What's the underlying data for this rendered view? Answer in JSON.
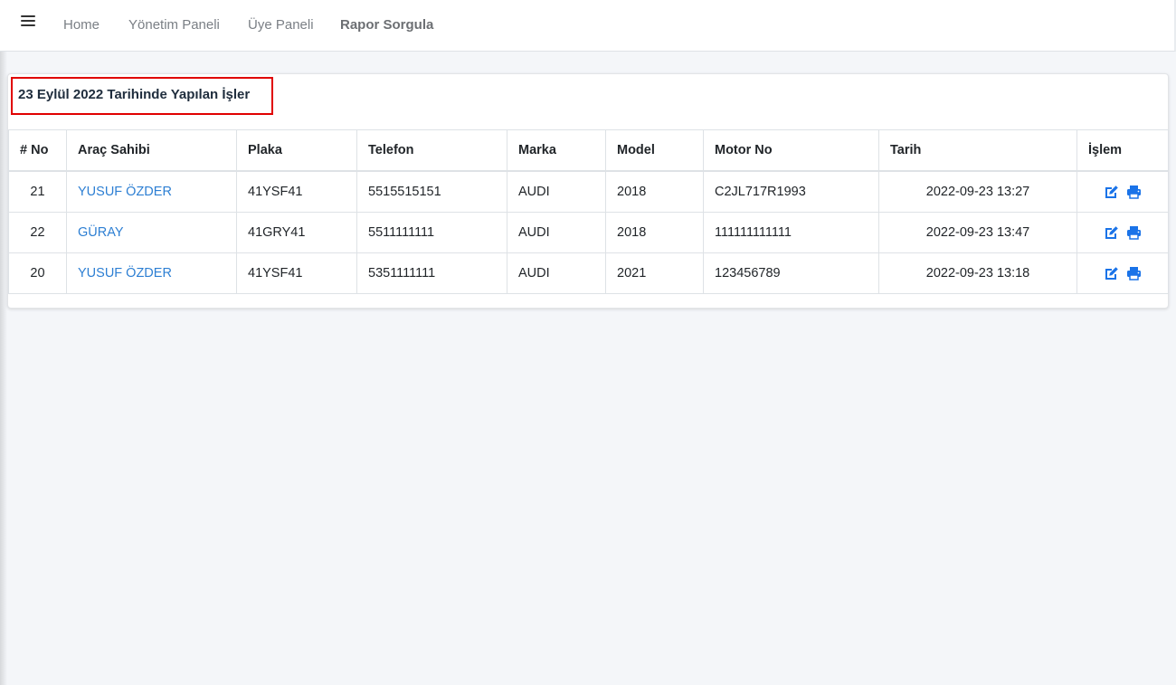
{
  "navbar": {
    "menu_icon": "hamburger-menu-icon",
    "links": [
      {
        "label": "Home"
      },
      {
        "label": "Yönetim Paneli"
      },
      {
        "label": "Üye Paneli"
      },
      {
        "label": "Rapor Sorgula"
      }
    ]
  },
  "card": {
    "title": "23 Eylül 2022 Tarihinde Yapılan İşler",
    "highlight_color": "#e00000"
  },
  "table": {
    "headers": [
      "# No",
      "Araç Sahibi",
      "Plaka",
      "Telefon",
      "Marka",
      "Model",
      "Motor No",
      "Tarih",
      "İşlem"
    ],
    "rows": [
      {
        "no": "21",
        "owner": "YUSUF ÖZDER",
        "plate": "41YSF41",
        "phone": "5515515151",
        "brand": "AUDI",
        "model": "2018",
        "engine": "C2JL717R1993",
        "date": "2022-09-23 13:27"
      },
      {
        "no": "22",
        "owner": "GÜRAY",
        "plate": "41GRY41",
        "phone": "5511111111",
        "brand": "AUDI",
        "model": "2018",
        "engine": "111111111111",
        "date": "2022-09-23 13:47"
      },
      {
        "no": "20",
        "owner": "YUSUF ÖZDER",
        "plate": "41YSF41",
        "phone": "5351111111",
        "brand": "AUDI",
        "model": "2021",
        "engine": "123456789",
        "date": "2022-09-23 13:18"
      }
    ],
    "action_icons": [
      "edit-icon",
      "print-icon"
    ],
    "link_color": "#2d7fd3",
    "icon_color": "#1a73e8"
  }
}
